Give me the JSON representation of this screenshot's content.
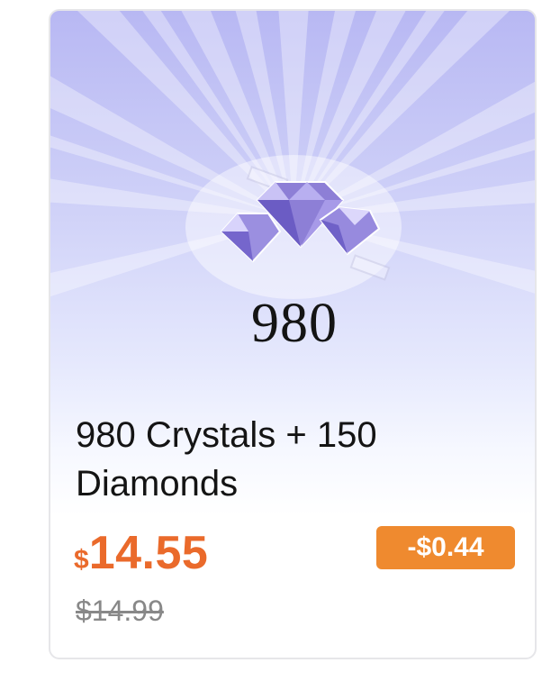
{
  "product": {
    "artwork_amount": "980",
    "title": "980 Crystals + 150 Diamonds",
    "price_currency": "$",
    "price_value": "14.55",
    "discount_badge": "-$0.44",
    "original_price": "$14.99"
  },
  "colors": {
    "accent_price": "#ea6a2b",
    "discount_badge_bg": "#ef8a2f",
    "card_gradient_top": "#b8b8f3"
  },
  "icons": {
    "gem_artwork": "crystal-cluster-icon"
  }
}
